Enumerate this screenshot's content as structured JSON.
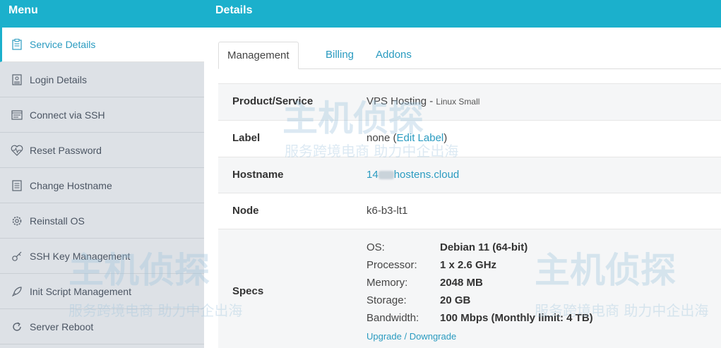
{
  "header": {
    "menu_title": "Menu",
    "details_title": "Details"
  },
  "sidebar": {
    "items": [
      {
        "label": "Service Details",
        "icon": "clipboard-icon"
      },
      {
        "label": "Login Details",
        "icon": "id-card-icon"
      },
      {
        "label": "Connect via SSH",
        "icon": "terminal-icon"
      },
      {
        "label": "Reset Password",
        "icon": "heartbeat-icon"
      },
      {
        "label": "Change Hostname",
        "icon": "document-icon"
      },
      {
        "label": "Reinstall OS",
        "icon": "gear-icon"
      },
      {
        "label": "SSH Key Management",
        "icon": "key-icon"
      },
      {
        "label": "Init Script Management",
        "icon": "rocket-icon"
      },
      {
        "label": "Server Reboot",
        "icon": "refresh-icon"
      }
    ]
  },
  "tabs": [
    {
      "label": "Management"
    },
    {
      "label": "Billing"
    },
    {
      "label": "Addons"
    }
  ],
  "details": {
    "product": {
      "label": "Product/Service",
      "value": "VPS Hosting",
      "separator": " - ",
      "sub": "Linux Small"
    },
    "label": {
      "label": "Label",
      "value": "none",
      "open": " (",
      "edit_link": "Edit Label",
      "close": ")"
    },
    "hostname": {
      "label": "Hostname",
      "prefix": "14",
      "suffix": "hostens.cloud"
    },
    "node": {
      "label": "Node",
      "value": "k6-b3-lt1"
    },
    "specs": {
      "label": "Specs",
      "lines": [
        {
          "key": "OS:",
          "value": "Debian 11 (64-bit)"
        },
        {
          "key": "Processor:",
          "value": "1 x 2.6 GHz"
        },
        {
          "key": "Memory:",
          "value": "2048 MB"
        },
        {
          "key": "Storage:",
          "value": "20 GB"
        },
        {
          "key": "Bandwidth:",
          "value": "100 Mbps (Monthly limit: 4 TB)"
        }
      ],
      "upgrade_link": "Upgrade / Downgrade"
    }
  },
  "watermark": {
    "brand": "主机侦探",
    "slogan": "服务跨境电商 助力中企出海"
  },
  "colors": {
    "accent": "#1bb0cc",
    "link": "#2a9bc0",
    "sidebar_bg": "#dde1e6"
  }
}
